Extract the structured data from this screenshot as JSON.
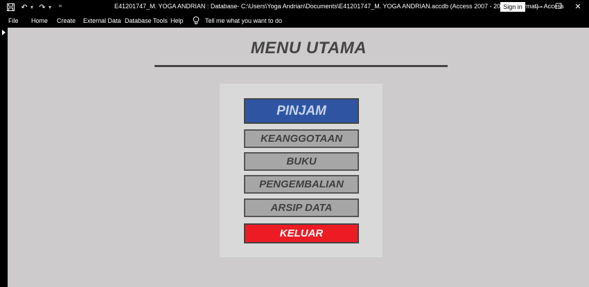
{
  "window": {
    "title": "E41201747_M. YOGA ANDRIAN : Database- C:\\Users\\Yoga Andrian\\Documents\\E41201747_M. YOGA ANDRIAN.accdb (Access 2007 - 2016 file format)  -  Access",
    "sign_in_label": "Sign in",
    "minimize": "—",
    "restore": "❐",
    "close": "✕"
  },
  "qat": {
    "save": "🖫",
    "undo": "↶",
    "redo": "↷",
    "customize": "⁼"
  },
  "ribbon": {
    "tabs": [
      "File",
      "Home",
      "Create",
      "External Data",
      "Database Tools",
      "Help"
    ],
    "tell_me": "Tell me what you want to do"
  },
  "form": {
    "title": "MENU UTAMA",
    "buttons": {
      "pinjam": "PINJAM",
      "keanggotaan": "KEANGGOTAAN",
      "buku": "BUKU",
      "pengembalian": "PENGEMBALIAN",
      "arsip_data": "ARSIP DATA",
      "keluar": "KELUAR"
    }
  },
  "colors": {
    "form_background": "#cdcbcc",
    "panel_background": "#d9d9d9",
    "pinjam_button": "#2f55a2",
    "gray_button": "#a6a6a6",
    "keluar_button": "#ed1c24"
  }
}
